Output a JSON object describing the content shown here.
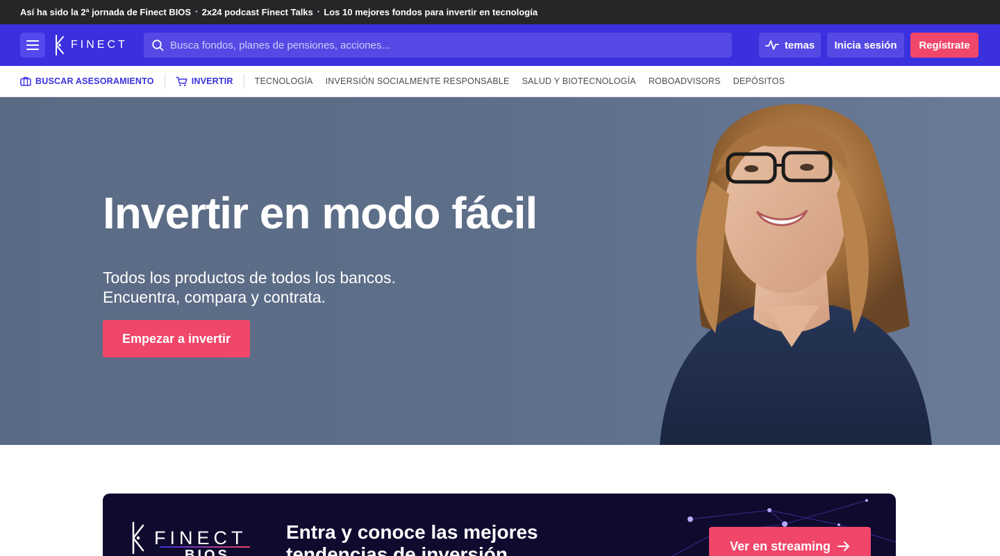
{
  "ticker": {
    "items": [
      "Así ha sido la 2ª jornada de Finect BIOS",
      "2x24 podcast Finect Talks",
      "Los 10 mejores fondos para invertir en tecnología"
    ],
    "separator": "•"
  },
  "header": {
    "logo_text": "FINECT",
    "search_placeholder": "Busca fondos, planes de pensiones, acciones...",
    "temas_label": "temas",
    "login_label": "Inicia sesión",
    "register_label": "Regístrate"
  },
  "subnav": {
    "primary": [
      "BUSCAR ASESORAMIENTO",
      "INVERTIR"
    ],
    "items": [
      "TECNOLOGÍA",
      "INVERSIÓN SOCIALMENTE RESPONSABLE",
      "SALUD Y BIOTECNOLOGÍA",
      "ROBOADVISORS",
      "DEPÓSITOS"
    ]
  },
  "hero": {
    "title": "Invertir en modo fácil",
    "subtitle_line1": "Todos los productos de todos los bancos.",
    "subtitle_line2": "Encuentra, compara y contrata.",
    "cta": "Empezar a invertir"
  },
  "banner": {
    "logo_text": "FINECT",
    "logo_sub": "BIOS",
    "heading_line1": "Entra y conoce las mejores",
    "heading_line2": "tendencias de inversión",
    "cta": "Ver en streaming"
  },
  "colors": {
    "brand_blue": "#3b30dd",
    "accent_pink": "#f0466a",
    "ticker_bg": "#262629",
    "banner_bg": "#0e0b2e"
  }
}
